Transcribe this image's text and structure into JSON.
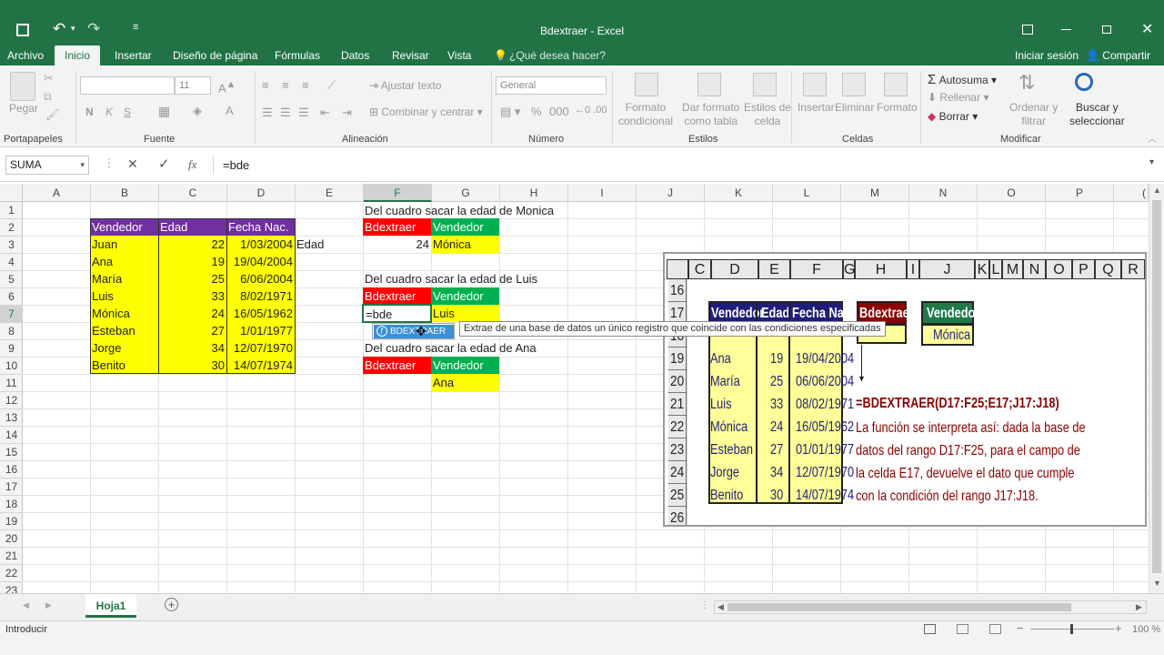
{
  "window": {
    "title": "Bdextraer - Excel"
  },
  "tabs": [
    "Archivo",
    "Inicio",
    "Insertar",
    "Diseño de página",
    "Fórmulas",
    "Datos",
    "Revisar",
    "Vista"
  ],
  "tellme": "¿Qué desea hacer?",
  "signin": "Iniciar sesión",
  "share": "Compartir",
  "ribbon": {
    "paste": "Pegar",
    "font_size": "11",
    "bold": "N",
    "italic": "K",
    "underline": "S",
    "wrap_text": "Ajustar texto",
    "merge_center": "Combinar y centrar",
    "number_format": "General",
    "cond_format": [
      "Formato",
      "condicional"
    ],
    "format_table": [
      "Dar formato",
      "como tabla"
    ],
    "cell_styles": [
      "Estilos de",
      "celda"
    ],
    "insert": "Insertar",
    "delete": "Eliminar",
    "format": "Formato",
    "autosum": "Autosuma",
    "fill": "Rellenar",
    "clear": "Borrar",
    "sort_filter": [
      "Ordenar y",
      "filtrar"
    ],
    "find_select": [
      "Buscar y",
      "seleccionar"
    ],
    "groups": [
      "Portapapeles",
      "Fuente",
      "Alineación",
      "Número",
      "Estilos",
      "Celdas",
      "Modificar"
    ]
  },
  "formula_bar": {
    "name_box": "SUMA",
    "fx": "fx",
    "content": "=bde"
  },
  "columns": [
    "A",
    "B",
    "C",
    "D",
    "E",
    "F",
    "G",
    "H",
    "I",
    "J",
    "K",
    "L",
    "M",
    "N",
    "O",
    "P",
    "("
  ],
  "rows": [
    "1",
    "2",
    "3",
    "4",
    "5",
    "6",
    "7",
    "8",
    "9",
    "10",
    "11",
    "12",
    "13",
    "14",
    "15",
    "16",
    "17",
    "18",
    "19",
    "20",
    "21",
    "22",
    "23"
  ],
  "sheet": {
    "headers": [
      "Vendedor",
      "Edad",
      "Fecha Nac."
    ],
    "records": [
      [
        "Juan",
        "22",
        "1/03/2004"
      ],
      [
        "Ana",
        "19",
        "19/04/2004"
      ],
      [
        "María",
        "25",
        "6/06/2004"
      ],
      [
        "Luis",
        "33",
        "8/02/1971"
      ],
      [
        "Mónica",
        "24",
        "16/05/1962"
      ],
      [
        "Esteban",
        "27",
        "1/01/1977"
      ],
      [
        "Jorge",
        "34",
        "12/07/1970"
      ],
      [
        "Benito",
        "30",
        "14/07/1974"
      ]
    ],
    "e3": "Edad",
    "blocks": [
      {
        "title": "Del cuadro sacar la edad de Monica",
        "label": "Bdextraer",
        "crit_header": "Vendedor",
        "result": "24",
        "crit": "Mónica"
      },
      {
        "title": "Del cuadro sacar la edad de Luis",
        "label": "Bdextraer",
        "crit_header": "Vendedor",
        "result": "=bde",
        "crit": "Luis"
      },
      {
        "title": "Del cuadro sacar la edad de Ana",
        "label": "Bdextraer",
        "crit_header": "Vendedor",
        "result": "",
        "crit": "Ana"
      }
    ],
    "autocomplete": "BDEXTRAER",
    "tooltip": "Extrae de una base de datos un único registro que coincide con las condiciones especificadas"
  },
  "image": {
    "cols": [
      "C",
      "D",
      "E",
      "F",
      "G",
      "H",
      "I",
      "J",
      "K",
      "L",
      "M",
      "N",
      "O",
      "P",
      "Q",
      "R"
    ],
    "rows": [
      "16",
      "17",
      "18",
      "19",
      "20",
      "21",
      "22",
      "23",
      "24",
      "25",
      "26"
    ],
    "headers": [
      "Vendedor",
      "Edad",
      "Fecha Nac."
    ],
    "records": [
      [
        "Ana",
        "19",
        "19/04/2004"
      ],
      [
        "María",
        "25",
        "06/06/2004"
      ],
      [
        "Luis",
        "33",
        "08/02/1971"
      ],
      [
        "Mónica",
        "24",
        "16/05/1962"
      ],
      [
        "Esteban",
        "27",
        "01/01/1977"
      ],
      [
        "Jorge",
        "34",
        "12/07/1970"
      ],
      [
        "Benito",
        "30",
        "14/07/1974"
      ]
    ],
    "bdextraer": "Bdextraer",
    "vendedor": "Vendedor",
    "monica": "Mónica",
    "formula": "=BDEXTRAER(D17:F25;E17;J17:J18)",
    "explanation": [
      "La función se interpreta así: dada la base de",
      "datos del rango D17:F25, para el campo de",
      "la celda E17, devuelve el dato que cumple",
      "con la condición del rango J17:J18."
    ]
  },
  "sheet_tab": "Hoja1",
  "status": {
    "mode": "Introducir",
    "zoom": "100 %"
  },
  "colors": {
    "excel_green": "#217346",
    "purple": "#7030a0",
    "yellow": "#ffff00",
    "red": "#ff0000",
    "green": "#00b050",
    "dark_red": "#8b0000",
    "dark_blue": "#1f1f7a"
  }
}
